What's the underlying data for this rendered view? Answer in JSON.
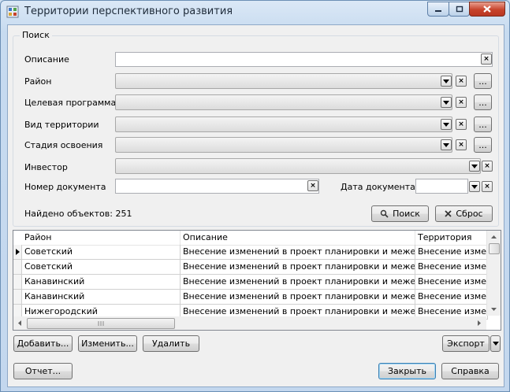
{
  "window": {
    "title": "Территории перспективного развития"
  },
  "search": {
    "group_title": "Поиск",
    "description_label": "Описание",
    "description_value": "",
    "district_label": "Район",
    "district_value": "",
    "target_program_label": "Целевая программа",
    "target_program_value": "",
    "territory_type_label": "Вид территории",
    "territory_type_value": "",
    "stage_label": "Стадия освоения",
    "stage_value": "",
    "investor_label": "Инвестор",
    "investor_value": "",
    "doc_number_label": "Номер документа",
    "doc_number_value": "",
    "doc_date_label": "Дата документа",
    "doc_date_value": "",
    "found_text": "Найдено объектов: 251",
    "search_button": "Поиск",
    "reset_button": "Сброс",
    "browse_label": "...",
    "clear_glyph": "×"
  },
  "grid": {
    "columns": [
      "Район",
      "Описание",
      "Территория"
    ],
    "rows": [
      [
        "Советский",
        "Внесение изменений в проект планировки и межевания те",
        "Внесение изменен"
      ],
      [
        "Советский",
        "Внесение изменений в проект планировки и межевания те",
        "Внесение изменен"
      ],
      [
        "Канавинский",
        "Внесение изменений в проект планировки и межевания те",
        "Внесение изменен"
      ],
      [
        "Канавинский",
        "Внесение изменений в проект планировки и межевания те",
        "Внесение изменен"
      ],
      [
        "Нижегородский",
        "Внесение изменений в проект планировки и межевания те",
        "Внесение изменен"
      ]
    ]
  },
  "actions": {
    "add": "Добавить...",
    "edit": "Изменить...",
    "delete": "Удалить",
    "export": "Экспорт",
    "report": "Отчет...",
    "close": "Закрыть",
    "help": "Справка"
  },
  "colors": {
    "title_bar": "#c7dbf0",
    "client_bg": "#f0f0f0",
    "close_button": "#c7432b"
  }
}
